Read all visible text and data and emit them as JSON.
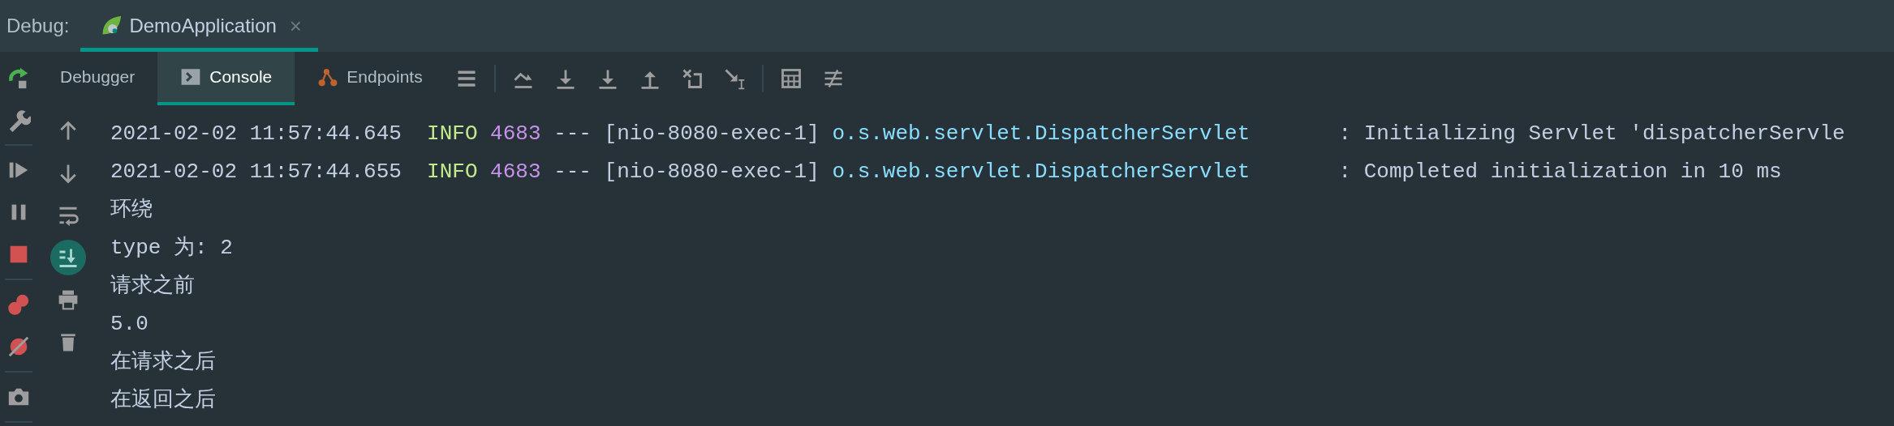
{
  "header": {
    "label": "Debug:",
    "tabs": [
      {
        "title": "DemoApplication",
        "close": "×",
        "selected": true
      }
    ]
  },
  "left_tools": [
    {
      "items": [
        {
          "kind": "rerun"
        },
        {
          "kind": "settings"
        }
      ]
    },
    {
      "items": [
        {
          "kind": "resume"
        },
        {
          "kind": "pause"
        },
        {
          "kind": "stop"
        }
      ]
    },
    {
      "items": [
        {
          "kind": "breakpoints"
        },
        {
          "kind": "mute"
        }
      ]
    },
    {
      "items": [
        {
          "kind": "camera"
        }
      ]
    }
  ],
  "toolbar": {
    "tabs": [
      {
        "label": "Debugger",
        "kind": "plain",
        "selected": false
      },
      {
        "label": "Console",
        "kind": "console",
        "selected": true
      },
      {
        "label": "Endpoints",
        "kind": "endpoints",
        "selected": false
      }
    ],
    "groups": [
      {
        "items": [
          {
            "kind": "menu"
          }
        ]
      },
      {
        "items": [
          {
            "kind": "step-over"
          },
          {
            "kind": "step-into"
          },
          {
            "kind": "force-step-into"
          },
          {
            "kind": "step-out"
          },
          {
            "kind": "drop-frame"
          },
          {
            "kind": "run-to-cursor"
          }
        ]
      },
      {
        "items": [
          {
            "kind": "evaluate"
          },
          {
            "kind": "trace"
          }
        ]
      }
    ]
  },
  "console_tools": [
    {
      "kind": "up",
      "on": false
    },
    {
      "kind": "down",
      "on": false
    },
    {
      "kind": "wrap",
      "on": false
    },
    {
      "kind": "scroll-end",
      "on": true
    },
    {
      "kind": "print",
      "on": false
    },
    {
      "kind": "trash",
      "on": false
    }
  ],
  "console": {
    "lines": [
      {
        "kind": "log",
        "timestamp": "2021-02-02 11:57:44.645",
        "level": "INFO",
        "pid": "4683",
        "separator": "---",
        "thread": "[nio-8080-exec-1]",
        "logger": "o.s.web.servlet.DispatcherServlet",
        "message": ": Initializing Servlet 'dispatcherServle"
      },
      {
        "kind": "log",
        "timestamp": "2021-02-02 11:57:44.655",
        "level": "INFO",
        "pid": "4683",
        "separator": "---",
        "thread": "[nio-8080-exec-1]",
        "logger": "o.s.web.servlet.DispatcherServlet",
        "message": ": Completed initialization in 10 ms"
      },
      {
        "kind": "text",
        "text": "环绕"
      },
      {
        "kind": "text",
        "text": "type 为: 2"
      },
      {
        "kind": "text",
        "text": "请求之前"
      },
      {
        "kind": "text",
        "text": "5.0"
      },
      {
        "kind": "text",
        "text": "在请求之后"
      },
      {
        "kind": "text",
        "text": "在返回之后"
      }
    ]
  }
}
